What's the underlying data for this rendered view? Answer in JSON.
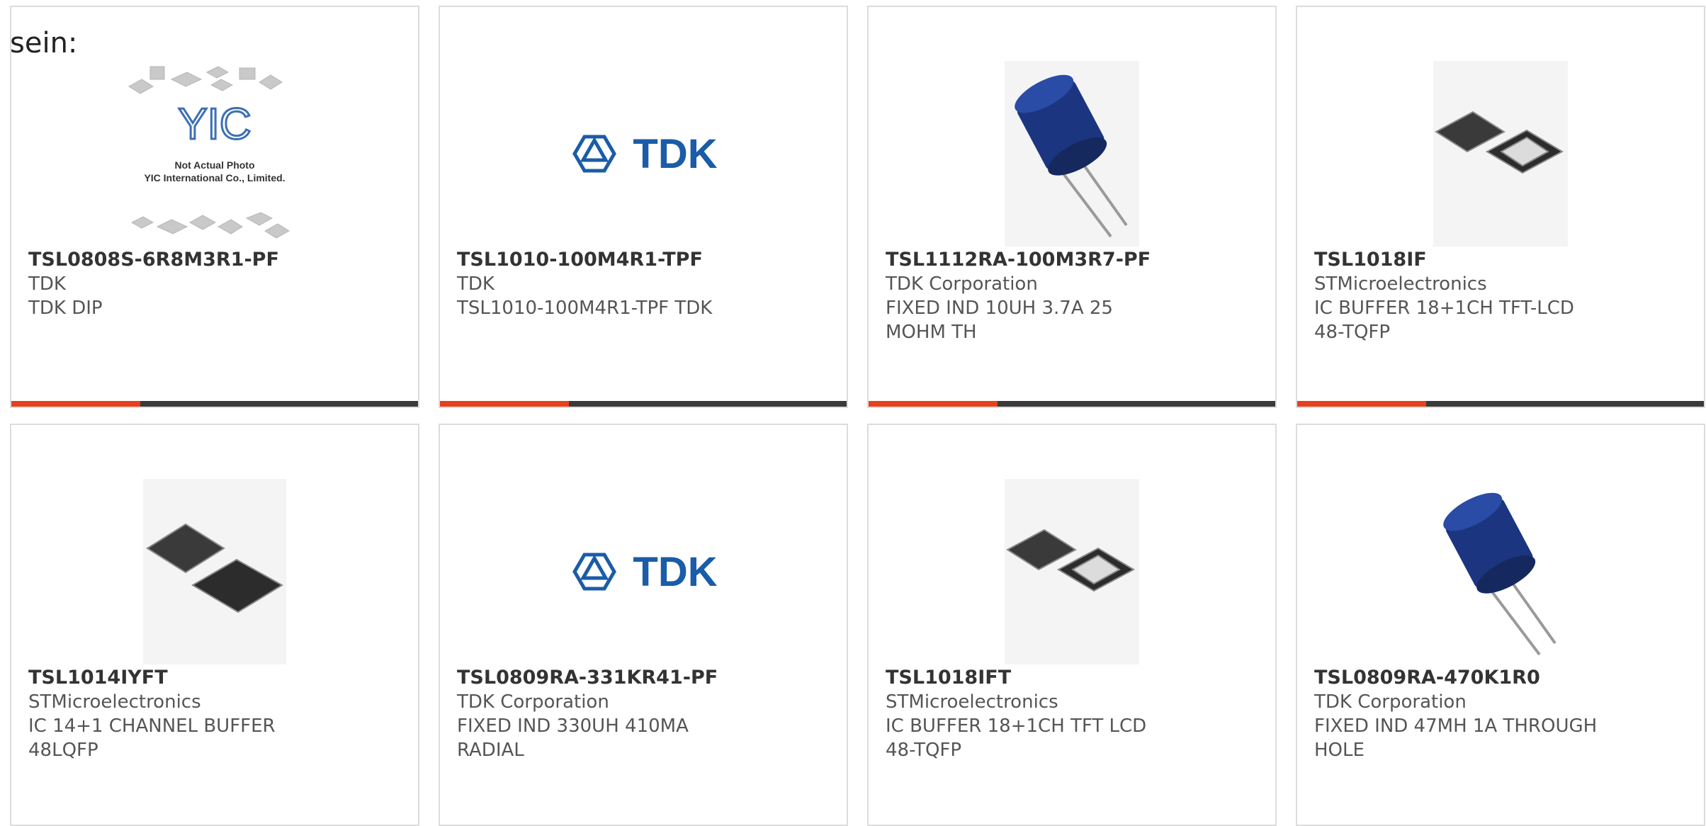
{
  "page": {
    "heading": "sein:"
  },
  "colors": {
    "accent": "#e8401c",
    "bar": "#3a3a3a",
    "border": "#dcdcdc",
    "tdk_blue": "#1a5ca8",
    "inductor_blue": "#1b3580"
  },
  "products": [
    {
      "part_number": "TSL0808S-6R8M3R1-PF",
      "manufacturer": "TDK",
      "description": "TDK DIP",
      "image": "placeholder-photo",
      "image_text": {
        "logo": "YIC",
        "line1": "Not Actual Photo",
        "line2": "YIC International Co., Limited."
      }
    },
    {
      "part_number": "TSL1010-100M4R1-TPF",
      "manufacturer": "TDK",
      "description": "TSL1010-100M4R1-TPF TDK",
      "image": "tdk-logo",
      "logo_text": "TDK"
    },
    {
      "part_number": "TSL1112RA-100M3R7-PF",
      "manufacturer": "TDK Corporation",
      "description": "FIXED IND 10UH 3.7A 25 MOHM TH",
      "image": "radial-inductor"
    },
    {
      "part_number": "TSL1018IF",
      "manufacturer": "STMicroelectronics",
      "description": "IC BUFFER 18+1CH TFT-LCD 48-TQFP",
      "image": "ic-chip-pair"
    },
    {
      "part_number": "TSL1014IYFT",
      "manufacturer": "STMicroelectronics",
      "description": "IC 14+1 CHANNEL BUFFER 48LQFP",
      "image": "ic-chip-pair-large"
    },
    {
      "part_number": "TSL0809RA-331KR41-PF",
      "manufacturer": "TDK Corporation",
      "description": "FIXED IND 330UH 410MA RADIAL",
      "image": "tdk-logo",
      "logo_text": "TDK"
    },
    {
      "part_number": "TSL1018IFT",
      "manufacturer": "STMicroelectronics",
      "description": "IC BUFFER 18+1CH TFT LCD 48-TQFP",
      "image": "ic-chip-pair"
    },
    {
      "part_number": "TSL0809RA-470K1R0",
      "manufacturer": "TDK Corporation",
      "description": "FIXED IND 47MH 1A THROUGH HOLE",
      "image": "radial-inductor"
    }
  ]
}
